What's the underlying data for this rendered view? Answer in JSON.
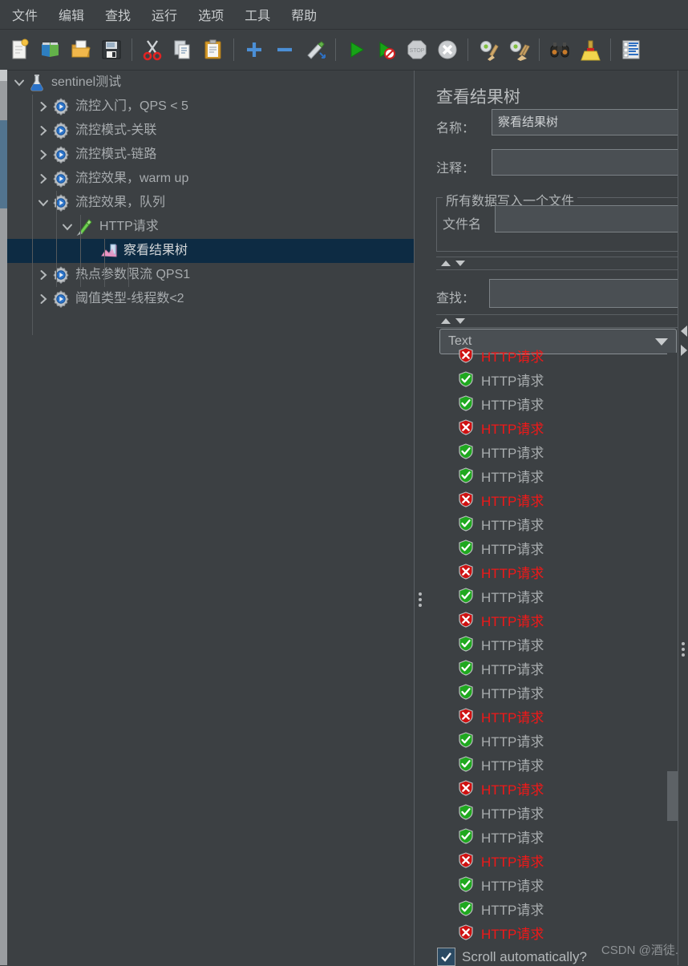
{
  "menubar": {
    "items": [
      {
        "label": "文件",
        "name": "menu-file"
      },
      {
        "label": "编辑",
        "name": "menu-edit"
      },
      {
        "label": "查找",
        "name": "menu-search"
      },
      {
        "label": "运行",
        "name": "menu-run"
      },
      {
        "label": "选项",
        "name": "menu-options"
      },
      {
        "label": "工具",
        "name": "menu-tools"
      },
      {
        "label": "帮助",
        "name": "menu-help"
      }
    ]
  },
  "toolbar": {
    "items": [
      {
        "icon": "new-file-icon",
        "type": "btn"
      },
      {
        "icon": "templates-icon",
        "type": "btn"
      },
      {
        "icon": "open-folder-icon",
        "type": "btn"
      },
      {
        "icon": "save-icon",
        "type": "btn"
      },
      {
        "type": "sep"
      },
      {
        "icon": "cut-scissors-icon",
        "type": "btn"
      },
      {
        "icon": "copy-icon",
        "type": "btn"
      },
      {
        "icon": "paste-icon",
        "type": "btn"
      },
      {
        "type": "sep"
      },
      {
        "icon": "expand-all-plus-icon",
        "type": "btn"
      },
      {
        "icon": "collapse-all-minus-icon",
        "type": "btn"
      },
      {
        "icon": "toggle-pen-icon",
        "type": "btn"
      },
      {
        "type": "sep"
      },
      {
        "icon": "start-play-icon",
        "type": "btn"
      },
      {
        "icon": "start-no-pauses-icon",
        "type": "btn"
      },
      {
        "icon": "stop-icon",
        "type": "btn"
      },
      {
        "icon": "shutdown-icon",
        "type": "btn"
      },
      {
        "type": "sep"
      },
      {
        "icon": "clear-icon",
        "type": "btn"
      },
      {
        "icon": "clear-all-icon",
        "type": "btn"
      },
      {
        "type": "sep"
      },
      {
        "icon": "search-binoculars-icon",
        "type": "btn"
      },
      {
        "icon": "search-reset-broom-icon",
        "type": "btn"
      },
      {
        "type": "sep"
      },
      {
        "icon": "function-helper-log-icon",
        "type": "btn"
      }
    ]
  },
  "tree": {
    "nodes": [
      {
        "label": "sentinel测试",
        "icon": "test-plan-flask-icon",
        "indent": 0,
        "twisty": "down",
        "selected": false
      },
      {
        "label": "流控入门，QPS < 5",
        "icon": "thread-group-gear-icon",
        "indent": 1,
        "twisty": "right",
        "selected": false
      },
      {
        "label": "流控模式-关联",
        "icon": "thread-group-gear-icon",
        "indent": 1,
        "twisty": "right",
        "selected": false
      },
      {
        "label": "流控模式-链路",
        "icon": "thread-group-gear-icon",
        "indent": 1,
        "twisty": "right",
        "selected": false
      },
      {
        "label": "流控效果，warm up",
        "icon": "thread-group-gear-icon",
        "indent": 1,
        "twisty": "right",
        "selected": false
      },
      {
        "label": "流控效果，队列",
        "icon": "thread-group-gear-icon",
        "indent": 1,
        "twisty": "down",
        "selected": false
      },
      {
        "label": "HTTP请求",
        "icon": "http-sampler-icon",
        "indent": 2,
        "twisty": "down",
        "selected": false
      },
      {
        "label": "察看结果树",
        "icon": "view-results-tree-icon",
        "indent": 3,
        "twisty": "none",
        "selected": true
      },
      {
        "label": "热点参数限流 QPS1",
        "icon": "thread-group-gear-icon",
        "indent": 1,
        "twisty": "right",
        "selected": false
      },
      {
        "label": "阈值类型-线程数<2",
        "icon": "thread-group-gear-icon",
        "indent": 1,
        "twisty": "right",
        "selected": false
      }
    ]
  },
  "panel": {
    "title": "查看结果树",
    "name_label": "名称：",
    "name_value": "察看结果树",
    "comment_label": "注释：",
    "comment_value": "",
    "group_title": "所有数据写入一个文件",
    "filename_label": "文件名",
    "filename_value": "",
    "search_label": "查找：",
    "search_value": "",
    "renderer_value": "Text",
    "scroll_label": "Scroll automatically?",
    "scroll_checked": true
  },
  "results": {
    "sampler_label": "HTTP请求",
    "statuses": [
      "err",
      "ok",
      "ok",
      "err",
      "ok",
      "ok",
      "err",
      "ok",
      "ok",
      "err",
      "ok",
      "err",
      "ok",
      "ok",
      "ok",
      "err",
      "ok",
      "ok",
      "err",
      "ok",
      "ok",
      "err",
      "ok",
      "ok",
      "err"
    ]
  },
  "watermark": {
    "text": "CSDN @酒徒."
  },
  "colors": {
    "bg": "#3c4043",
    "selection": "#0d2b43",
    "error_text": "#f11818",
    "ok_text": "#a8acae",
    "field_bg": "#4a4f53",
    "scroll_thumb_blue": "#52748f"
  }
}
